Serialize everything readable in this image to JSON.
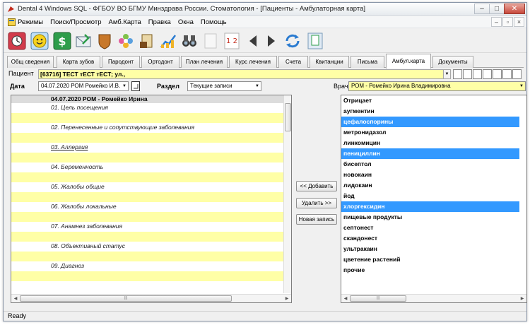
{
  "window": {
    "title": "Dental 4 Windows SQL - ФГБОУ ВО БГМУ Минздрава России. Стоматология - [Пациенты - Амбулаторная карта]",
    "controls": [
      "–",
      "□",
      "✕"
    ]
  },
  "menu": {
    "items": [
      "Режимы",
      "Поиск/Просмотр",
      "Амб.Карта",
      "Правка",
      "Окна",
      "Помощь"
    ],
    "right_controls": [
      "–",
      "▫",
      "×"
    ]
  },
  "toolbar": {
    "icons": [
      "clock-icon",
      "smiley-icon",
      "dollar-icon",
      "envelope-icon",
      "shield-icon",
      "flower-icon",
      "scroll-icon",
      "chart-icon",
      "binoculars-icon",
      "blank-page-icon",
      "sort-icon",
      "arrow-left-icon",
      "arrow-right-icon",
      "refresh-icon",
      "document-icon"
    ],
    "sort_label": "1 2"
  },
  "tabs": [
    "Общ сведения",
    "Карта зубов",
    "Пародонт",
    "Ортодонт",
    "План лечения",
    "Курс лечения",
    "Счета",
    "Квитанции",
    "Письма",
    "Амбул.карта",
    "Документы"
  ],
  "active_tab": "Амбул.карта",
  "patient": {
    "label": "Пациент",
    "value": "[63716] ТЕСТ тЕСТ тЕСТ; ул.,"
  },
  "filters": {
    "date_label": "Дата",
    "date_value": "04.07.2020 РОМ Ромейко И.В.",
    "section_label": "Раздел",
    "section_value": "Текущие записи",
    "doctor_label": "Врач",
    "doctor_value": "РОМ - Ромейко Ирина Владимировна"
  },
  "record": {
    "header": "04.07.2020 РОМ - Ромейко Ирина",
    "sections": [
      "01. Цель посещения",
      "02. Перенесенные и сопутствующие заболевания",
      "03. Аллергия",
      "04. Беременность",
      "05. Жалобы общие",
      "06. Жалобы локальные",
      "07. Анамнез заболевания",
      "08. Объективный статус",
      "09. Диагноз"
    ]
  },
  "buttons": {
    "add": "<< Добавить",
    "remove": "Удалить >>",
    "new_record": "Новая запись"
  },
  "options": {
    "items": [
      "Отрицает",
      "аугментин",
      "цефалоспорины",
      "метронидазол",
      "линкомицин",
      "пенициллин",
      "бисептол",
      "новокаин",
      "лидокаин",
      "йод",
      "хлоргексидин",
      "пищевые продукты",
      "септонест",
      "скандонест",
      "ультракаин",
      "цветение растений",
      "прочие"
    ],
    "selected": [
      "цефалоспорины",
      "пенициллин",
      "хлоргексидин"
    ]
  },
  "status": {
    "text": "Ready"
  },
  "colors": {
    "highlight_yellow": "#ffffa6",
    "selection_blue": "#3399ff"
  }
}
